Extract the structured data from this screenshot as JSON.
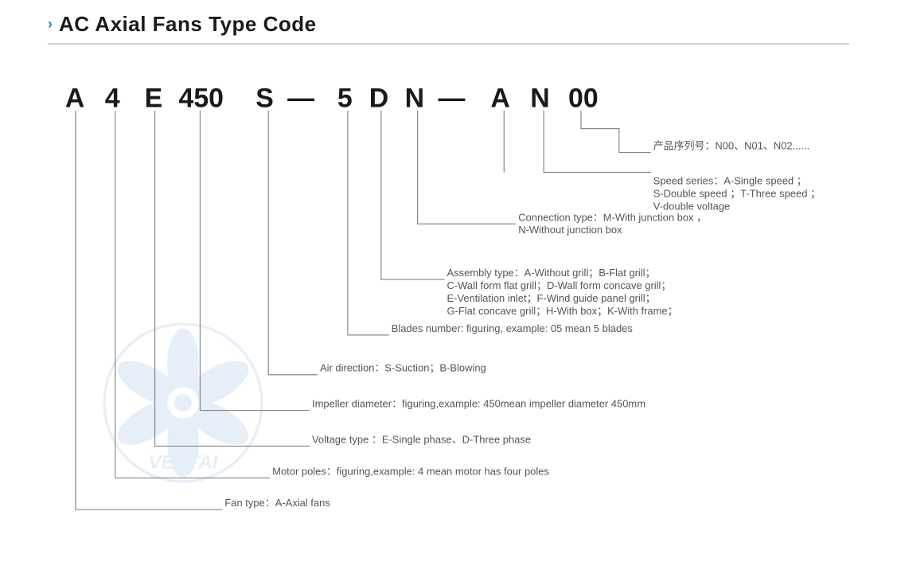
{
  "header": {
    "chevron": "›",
    "title": "AC Axial Fans Type Code"
  },
  "code": {
    "letters": [
      "A",
      "4",
      "E",
      "450",
      "S",
      "—",
      "5",
      "D",
      "N",
      "—",
      "A",
      "N",
      "00"
    ]
  },
  "annotations": [
    {
      "id": "product-series",
      "label_zh": "产品序列号：N00、N01、N02......",
      "label_en": ""
    },
    {
      "id": "speed-series",
      "label": "Speed series：A-Single speed ；",
      "label2": "S-Double speed ；T-Three speed ；",
      "label3": "V-double voltage"
    },
    {
      "id": "connection-type",
      "label": "Connection type：M-With junction box ，",
      "label2": "N-Without junction box"
    },
    {
      "id": "assembly-type",
      "label": "Assembly type：A-Without grill；B-Flat grill；",
      "label2": "C-Wall form flat grill；D-Wall form concave grill；",
      "label3": "E-Ventilation inlet；F-Wind guide panel grill；",
      "label4": "G-Flat concave grill；H-With box；K-With frame；"
    },
    {
      "id": "blades-number",
      "label": "Blades number: figuring, example: 05 mean 5 blades"
    },
    {
      "id": "air-direction",
      "label": "Air direction：S-Suction；B-Blowing"
    },
    {
      "id": "impeller-diameter",
      "label": "Impeller diameter：figuring,example: 450mean impeller diameter 450mm"
    },
    {
      "id": "voltage-type",
      "label": "Voltage type ：E-Single phase、D-Three phase"
    },
    {
      "id": "motor-poles",
      "label": "Motor poles：figuring,example: 4 mean motor has four poles"
    },
    {
      "id": "fan-type",
      "label": "Fan type：A-Axial fans"
    }
  ]
}
